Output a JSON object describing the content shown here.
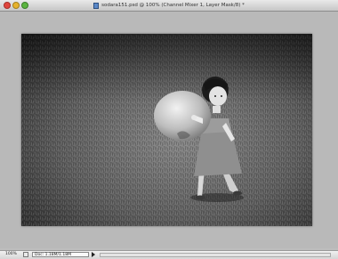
{
  "window": {
    "title": "sodara151.psd @ 100% (Channel Mixer 1, Layer Mask/8) *"
  },
  "canvas": {
    "image_description": "black and white photo"
  },
  "statusbar": {
    "zoom": "100%",
    "doc_info": "Doc: 1.18M/1.18M"
  },
  "colors": {
    "close": "#e0463e",
    "minimize": "#e6b22c",
    "zoom": "#5bb540"
  }
}
